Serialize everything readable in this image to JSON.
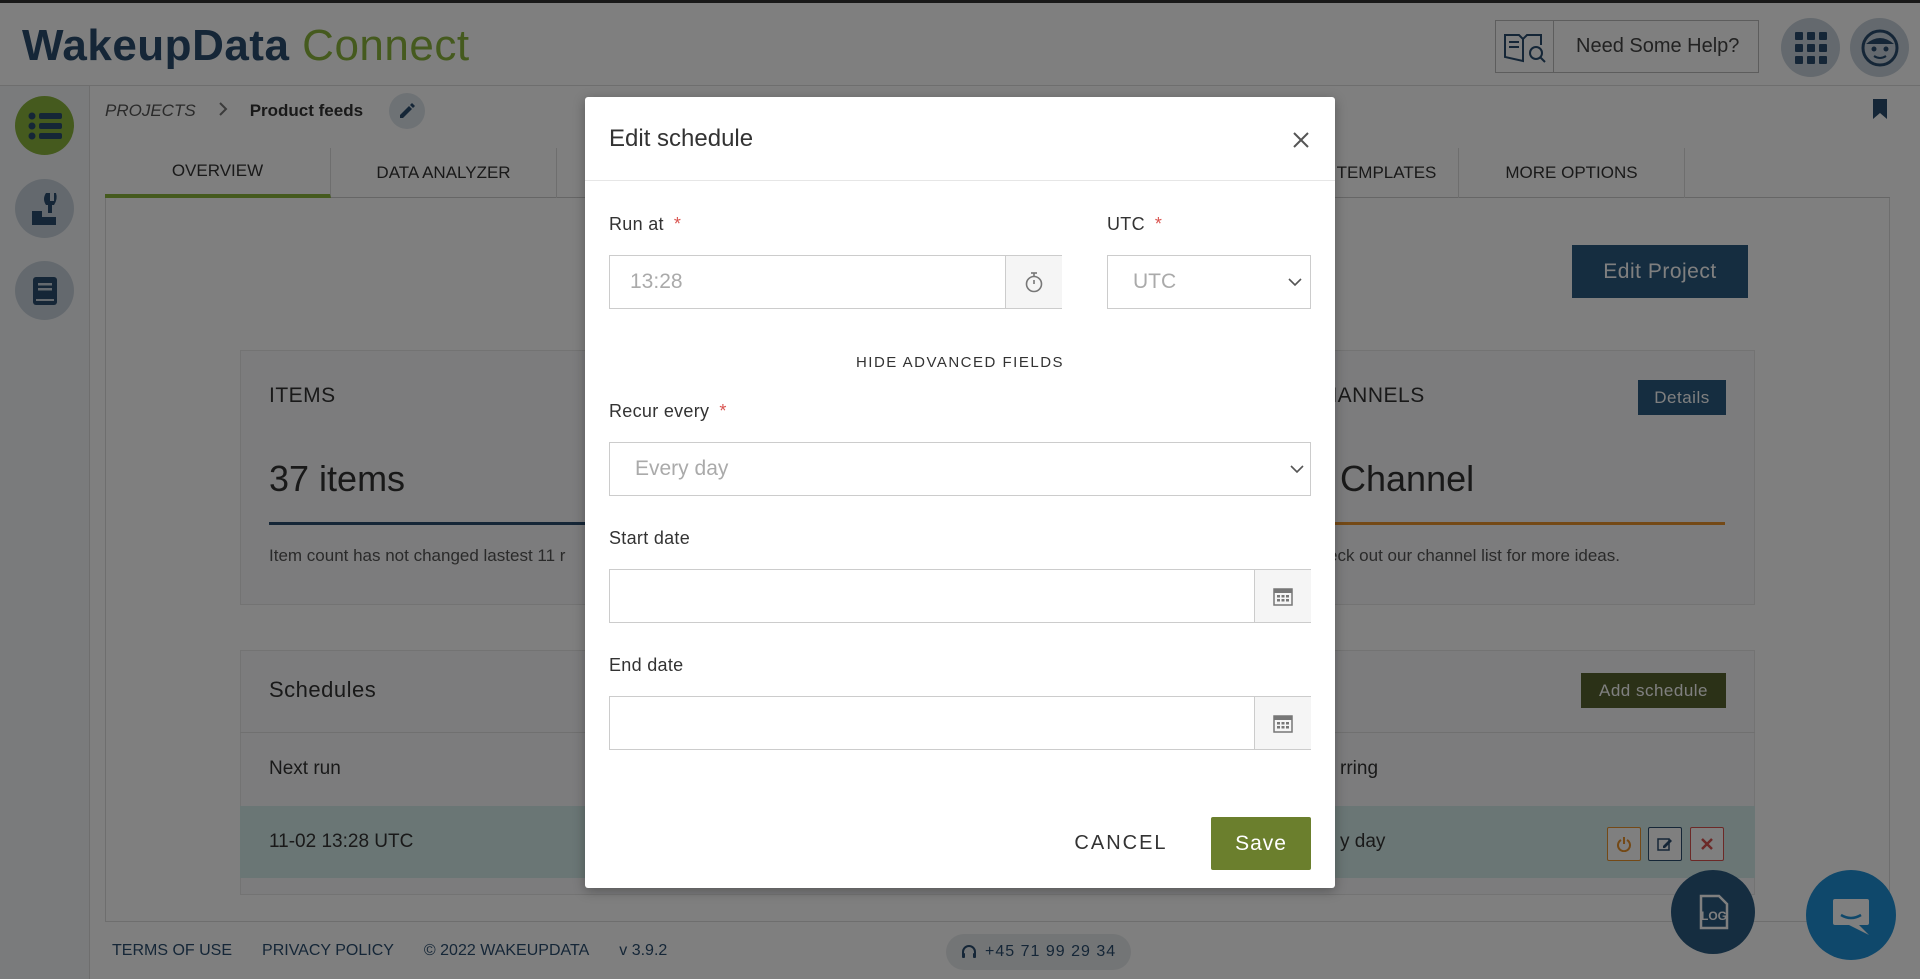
{
  "header": {
    "logo_main": "WakeupData",
    "logo_accent": "Connect",
    "help_label": "Need Some Help?",
    "icons": [
      "help-book-icon",
      "apps-grid-icon",
      "user-avatar-icon"
    ]
  },
  "sidebar": {
    "items": [
      {
        "icon": "list-icon",
        "color": "#8ab43c"
      },
      {
        "icon": "tools-icon",
        "color": "#2a4d6e"
      },
      {
        "icon": "book-icon",
        "color": "#2a4d6e"
      }
    ]
  },
  "breadcrumb": {
    "root": "PROJECTS",
    "current": "Product feeds"
  },
  "tabs": [
    {
      "label": "OVERVIEW",
      "active": true
    },
    {
      "label": "DATA ANALYZER",
      "active": false
    },
    {
      "label": "TEMPLATES",
      "active": false
    },
    {
      "label": "MORE OPTIONS",
      "active": false
    }
  ],
  "page": {
    "edit_project_label": "Edit Project"
  },
  "items_card": {
    "title": "ITEMS",
    "count": "37 items",
    "note": "Item count has not changed lastest 11 r"
  },
  "channels_card": {
    "title": "HANNELS",
    "details_label": "Details",
    "count": "Channel",
    "note": "eck out our channel list for more ideas."
  },
  "schedules": {
    "title": "Schedules",
    "add_label": "Add schedule",
    "col_next_run": "Next run",
    "col_recurring": "rring",
    "row_next_run": "11-02 13:28 UTC",
    "row_recurring": "y day"
  },
  "footer": {
    "links": [
      "TERMS OF USE",
      "PRIVACY POLICY",
      "© 2022 WAKEUPDATA",
      "v 3.9.2"
    ],
    "phone": "+45 71 99 29 34",
    "log_label": "LOG"
  },
  "modal": {
    "title": "Edit schedule",
    "run_at": {
      "label": "Run at",
      "required": "*",
      "value": "13:28"
    },
    "timezone": {
      "label": "UTC",
      "required": "*",
      "value": "UTC"
    },
    "advanced_toggle": "HIDE ADVANCED FIELDS",
    "recur_every": {
      "label": "Recur every",
      "required": "*",
      "value": "Every day"
    },
    "start_date": {
      "label": "Start date",
      "value": ""
    },
    "end_date": {
      "label": "End date",
      "value": ""
    },
    "cancel_label": "CANCEL",
    "save_label": "Save"
  },
  "colors": {
    "brand_dark": "#2a4d6e",
    "brand_green": "#8ab43c",
    "save_green": "#6b7f2d",
    "required_red": "#d9534f"
  }
}
